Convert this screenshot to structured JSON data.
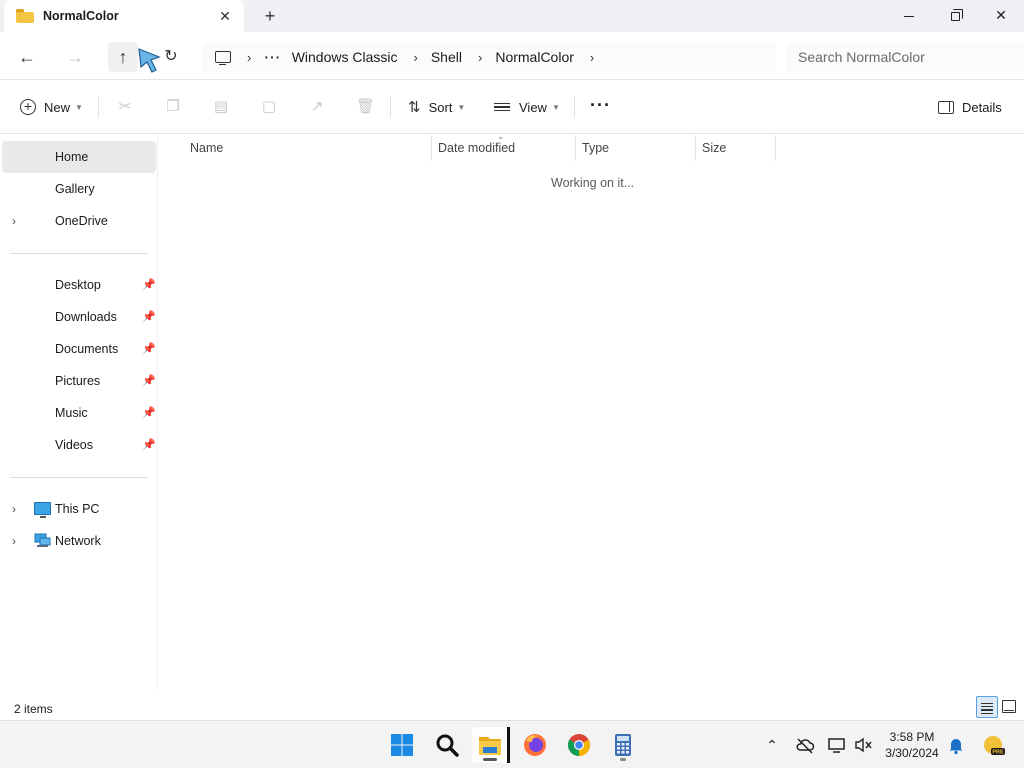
{
  "window": {
    "tab_title": "NormalColor",
    "new_tab_glyph": "+",
    "close_glyph": "✕"
  },
  "address": {
    "breadcrumb_overflow": "···",
    "breadcrumb": [
      "Windows Classic",
      "Shell",
      "NormalColor"
    ],
    "search_placeholder": "Search NormalColor"
  },
  "commands": {
    "new_label": "New",
    "sort_label": "Sort",
    "view_label": "View",
    "more_glyph": "···",
    "details_label": "Details"
  },
  "sidebar": {
    "top_items": [
      {
        "label": "Home",
        "selected": true
      },
      {
        "label": "Gallery"
      },
      {
        "label": "OneDrive",
        "expandable": true
      }
    ],
    "pinned": [
      {
        "label": "Desktop"
      },
      {
        "label": "Downloads"
      },
      {
        "label": "Documents"
      },
      {
        "label": "Pictures"
      },
      {
        "label": "Music"
      },
      {
        "label": "Videos"
      }
    ],
    "locations": [
      {
        "label": "This PC",
        "icon": "pc-icon"
      },
      {
        "label": "Network",
        "icon": "network-icon"
      }
    ]
  },
  "filelist": {
    "columns": [
      "Name",
      "Date modified",
      "Type",
      "Size"
    ],
    "loading_text": "Working on it..."
  },
  "status": {
    "item_count": "2 items"
  },
  "taskbar": {
    "time": "3:58 PM",
    "date": "3/30/2024",
    "apps": [
      "start-icon",
      "search-icon",
      "file-explorer-icon",
      "firefox-icon",
      "chrome-icon",
      "calculator-icon"
    ]
  },
  "colors": {
    "accent": "#0067c0",
    "selected_nav": "#e9e9e9",
    "folder_yellow": "#f4c542"
  }
}
